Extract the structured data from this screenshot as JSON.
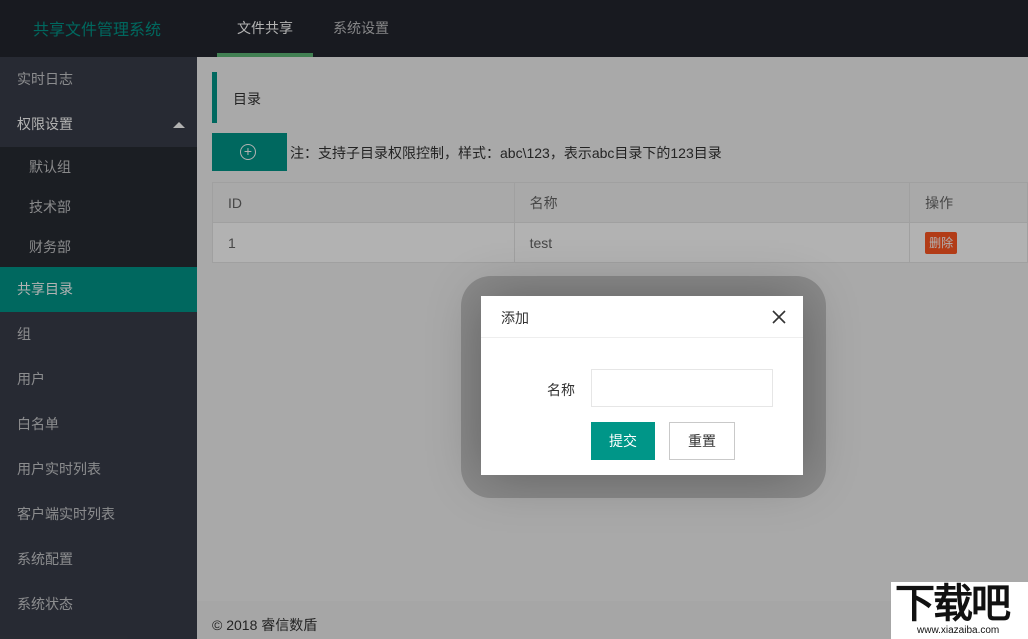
{
  "app": {
    "title": "共享文件管理系统"
  },
  "top_nav": [
    {
      "label": "文件共享",
      "active": true
    },
    {
      "label": "系统设置",
      "active": false
    }
  ],
  "sidebar": {
    "items": [
      {
        "label": "实时日志"
      },
      {
        "label": "权限设置",
        "expanded": true,
        "children": [
          {
            "label": "默认组"
          },
          {
            "label": "技术部"
          },
          {
            "label": "财务部"
          }
        ]
      },
      {
        "label": "共享目录",
        "active": true
      },
      {
        "label": "组"
      },
      {
        "label": "用户"
      },
      {
        "label": "白名单"
      },
      {
        "label": "用户实时列表"
      },
      {
        "label": "客户端实时列表"
      },
      {
        "label": "系统配置"
      },
      {
        "label": "系统状态"
      }
    ]
  },
  "main": {
    "section_title": "目录",
    "note": "注：支持子目录权限控制，样式：abc\\123，表示abc目录下的123目录",
    "table": {
      "headers": [
        "ID",
        "名称",
        "操作"
      ],
      "rows": [
        {
          "id": "1",
          "name": "test",
          "action": "删除"
        }
      ]
    }
  },
  "footer": {
    "text": "© 2018 睿信数盾"
  },
  "dialog": {
    "title": "添加",
    "field_label": "名称",
    "field_value": "",
    "submit_label": "提交",
    "reset_label": "重置"
  },
  "watermark": {
    "brand": "下载吧",
    "url": "www.xiazaiba.com"
  },
  "colors": {
    "accent": "#009688",
    "header_bg": "#23262e",
    "sidebar_bg": "#393d49",
    "danger": "#ff5722"
  }
}
